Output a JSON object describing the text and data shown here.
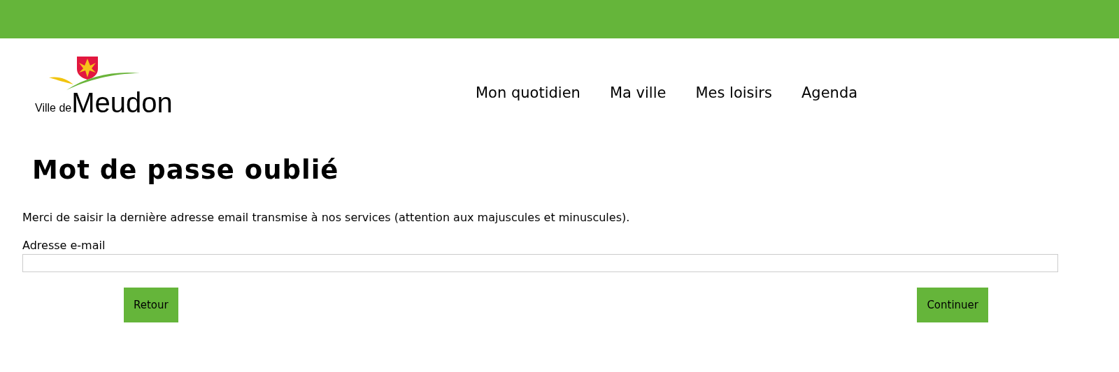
{
  "logo": {
    "small": "Ville de",
    "large": "Meudon"
  },
  "nav": [
    {
      "label": "Mon quotidien"
    },
    {
      "label": "Ma ville"
    },
    {
      "label": "Mes loisirs"
    },
    {
      "label": "Agenda"
    }
  ],
  "title": "Mot de passe oublié",
  "intro": "Merci de saisir la dernière adresse email transmise à nos services (attention aux majuscules et minuscules).",
  "field": {
    "label": "Adresse e-mail"
  },
  "buttons": [
    {
      "label": "Retour"
    },
    {
      "label": "Continuer"
    }
  ]
}
